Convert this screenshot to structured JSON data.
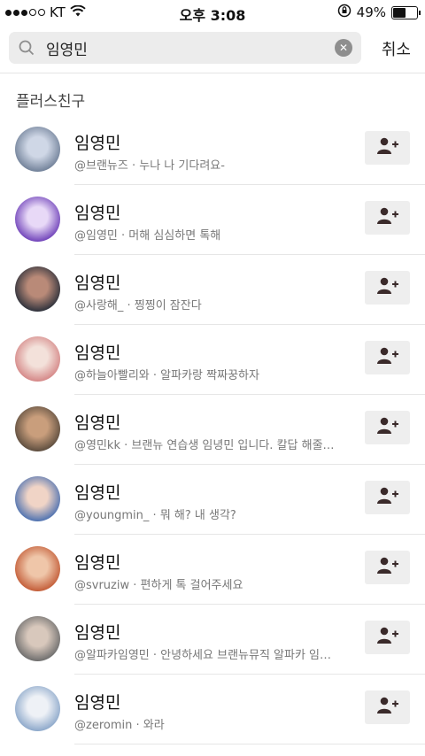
{
  "status_bar": {
    "carrier": "KT",
    "time": "오후 3:08",
    "battery": "49%",
    "battery_level": 0.49
  },
  "search": {
    "query": "임영민",
    "cancel_label": "취소"
  },
  "section_title": "플러스친구",
  "results": [
    {
      "name": "임영민",
      "handle": "@브랜뉴즈",
      "desc": "누나 나 기다려요-",
      "avatar_colors": [
        "#6f7f97",
        "#cfd7e6"
      ],
      "add_icon": "add-friend-icon"
    },
    {
      "name": "임영민",
      "handle": "@임영민",
      "desc": "머해 심심하면 톡해",
      "avatar_colors": [
        "#6d3fb8",
        "#e8d9f7"
      ],
      "add_icon": "add-friend-icon"
    },
    {
      "name": "임영민",
      "handle": "@사랑해_",
      "desc": "찡찡이 잠잔다",
      "avatar_colors": [
        "#2a2f3a",
        "#b98a78"
      ],
      "add_icon": "add-friend-icon"
    },
    {
      "name": "임영민",
      "handle": "@하늘아빨리와",
      "desc": "알파카랑 짝짜꿍하자",
      "avatar_colors": [
        "#d48585",
        "#f3e1da"
      ],
      "add_icon": "add-friend-icon"
    },
    {
      "name": "임영민",
      "handle": "@영민kk",
      "desc": "브랜뉴 연습생 임녕민 입니다. 칼답 해줄…",
      "avatar_colors": [
        "#5a4b3d",
        "#c99e7c"
      ],
      "add_icon": "add-friend-icon"
    },
    {
      "name": "임영민",
      "handle": "@youngmin_",
      "desc": "뭐 해? 내 생각?",
      "avatar_colors": [
        "#4a6fb0",
        "#f0d4c6"
      ],
      "add_icon": "add-friend-icon"
    },
    {
      "name": "임영민",
      "handle": "@svruziw",
      "desc": "편하게 톡 걸어주세요",
      "avatar_colors": [
        "#c25a35",
        "#efc6a9"
      ],
      "add_icon": "add-friend-icon"
    },
    {
      "name": "임영민",
      "handle": "@알파카임영민",
      "desc": "안녕하세요 브랜뉴뮤직 알파카 임…",
      "avatar_colors": [
        "#6b6b6b",
        "#d8c8bc"
      ],
      "add_icon": "add-friend-icon"
    },
    {
      "name": "임영민",
      "handle": "@zeromin",
      "desc": "와라",
      "avatar_colors": [
        "#8aa6c9",
        "#eef1f6"
      ],
      "add_icon": "add-friend-icon"
    }
  ]
}
